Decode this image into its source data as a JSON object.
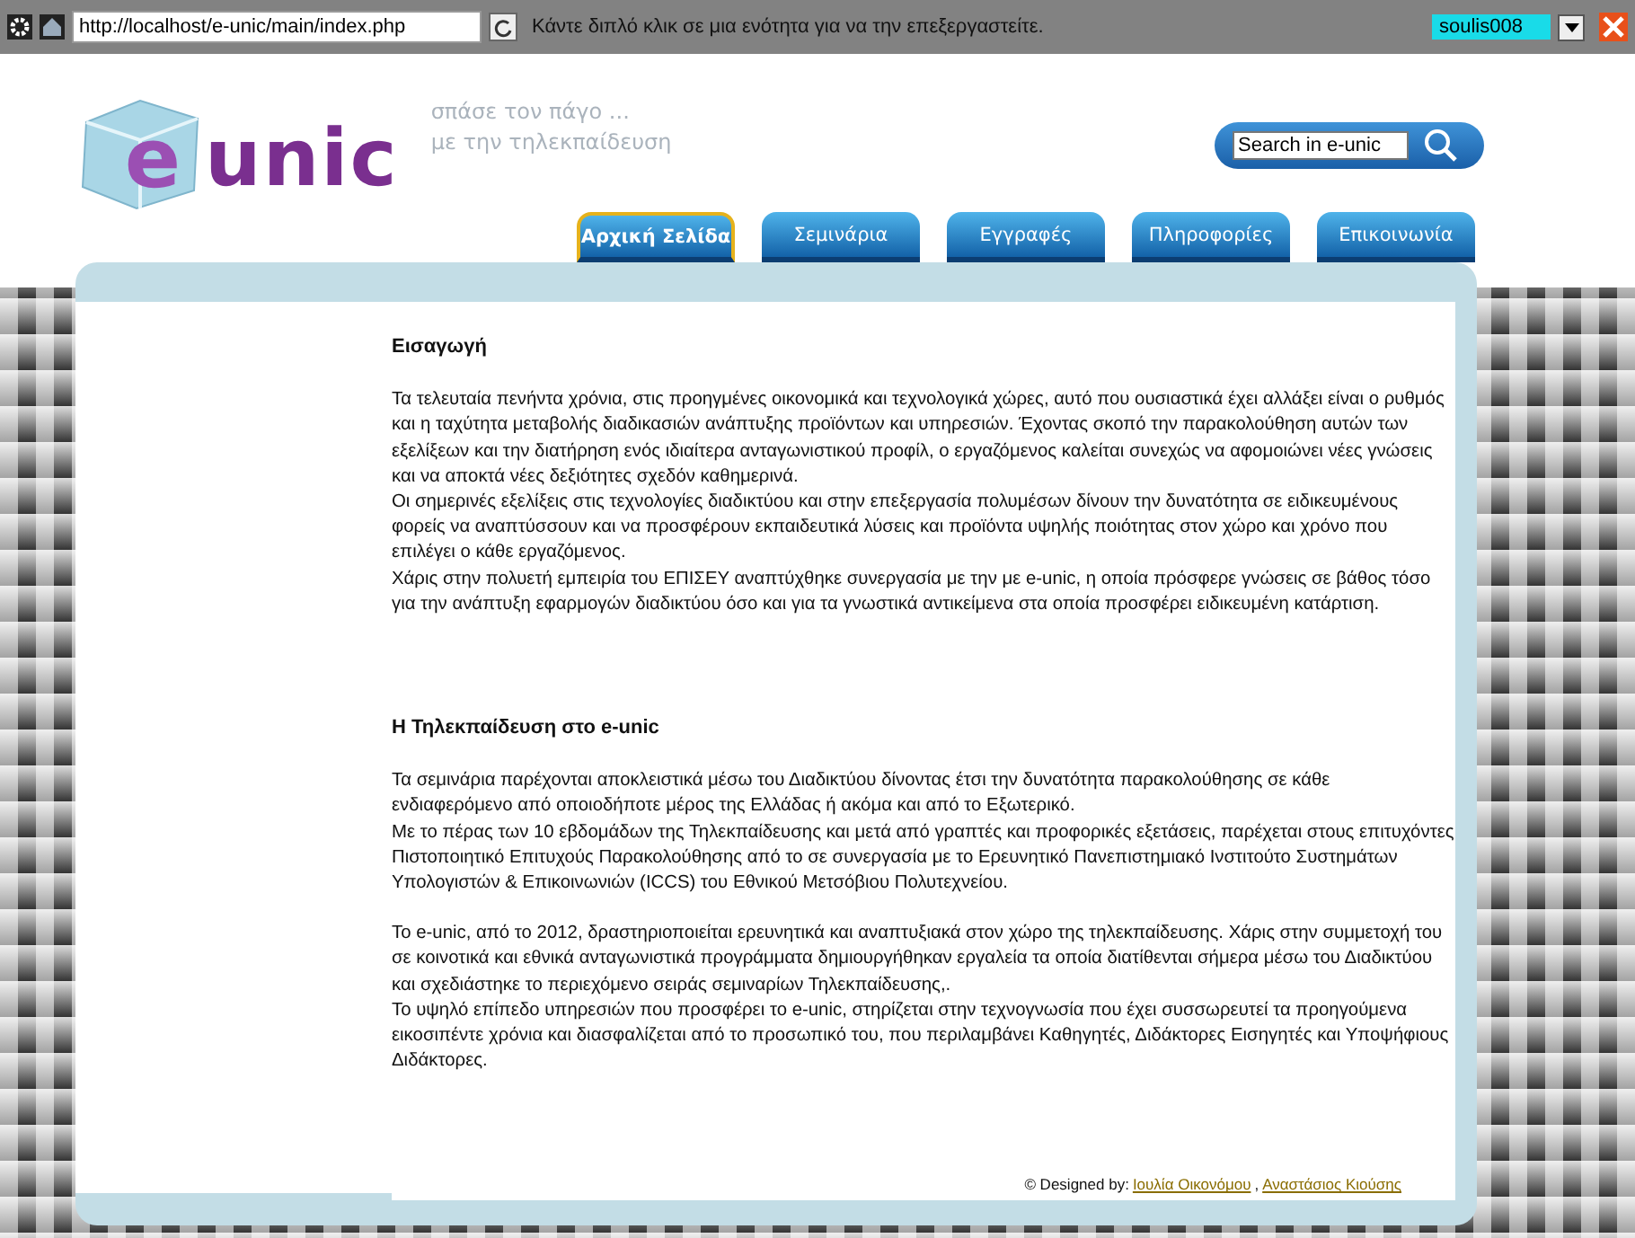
{
  "toolbar": {
    "address": "http://localhost/e-unic/main/index.php",
    "hint": "Κάντε διπλό κλικ σε μια ενότητα για να την επεξεργαστείτε.",
    "user": "soulis008"
  },
  "header": {
    "logo": {
      "letter": "e",
      "word": "unic"
    },
    "tagline": [
      "σπάσε τον πάγο ...",
      "με την τηλεκπαίδευση"
    ],
    "search": {
      "value": "Search in e-unic"
    }
  },
  "tabs": [
    {
      "label": "Αρχική Σελίδα",
      "selected": true
    },
    {
      "label": "Σεμινάρια",
      "selected": false
    },
    {
      "label": "Εγγραφές",
      "selected": false
    },
    {
      "label": "Πληροφορίες",
      "selected": false
    },
    {
      "label": "Επικοινωνία",
      "selected": false
    }
  ],
  "sections": [
    {
      "title": "Εισαγωγή",
      "paragraphs": [
        [
          "Τα τελευταία πενήντα χρόνια, στις προηγμένες οικονομικά και τεχνολογικά χώρες, αυτό που ουσιαστικά έχει αλλάξει είναι ο ρυθμός και η ταχύτητα μεταβολής διαδικασιών ανάπτυξης προϊόντων και υπηρεσιών. Έχοντας σκοπό την παρακολούθηση αυτών των εξελίξεων και την διατήρηση ενός ιδιαίτερα ανταγωνιστικού προφίλ, ο εργαζόμενος καλείται συνεχώς να αφομοιώνει νέες γνώσεις και να αποκτά νέες δεξιότητες σχεδόν καθημερινά.",
          "Οι σημερινές εξελίξεις στις τεχνολογίες διαδικτύου και στην επεξεργασία πολυμέσων δίνουν την δυνατότητα σε ειδικευμένους φορείς να αναπτύσσουν και να προσφέρουν εκπαιδευτικά λύσεις και προϊόντα υψηλής ποιότητας στον χώρο και χρόνο που επιλέγει ο κάθε εργαζόμενος.",
          "Χάρις στην πολυετή εμπειρία του ΕΠΙΣΕΥ αναπτύχθηκε συνεργασία με την με e-unic, η οποία πρόσφερε γνώσεις σε βάθος τόσο για την ανάπτυξη εφαρμογών διαδικτύου όσο και για τα γνωστικά αντικείμενα στα οποία προσφέρει ειδικευμένη κατάρτιση."
        ]
      ]
    },
    {
      "title": "Η Τηλεκπαίδευση στο e-unic",
      "paragraphs": [
        [
          "Τα σεμινάρια παρέχονται αποκλειστικά μέσω του Διαδικτύου δίνοντας έτσι την δυνατότητα παρακολούθησης σε κάθε ενδιαφερόμενο από οποιοδήποτε μέρος της Ελλάδας ή ακόμα και από το Εξωτερικό.",
          "Με το πέρας των 10 εβδομάδων της Τηλεκπαίδευσης και μετά από γραπτές και προφορικές εξετάσεις, παρέχεται στους επιτυχόντες Πιστοποιητικό Επιτυχούς Παρακολούθησης από το σε συνεργασία με το Ερευνητικό Πανεπιστημιακό Ινστιτούτο Συστημάτων Υπολογιστών & Επικοινωνιών (ICCS) του Εθνικού Μετσόβιου Πολυτεχνείου."
        ],
        [
          "Το e-unic, από το 2012, δραστηριοποιείται ερευνητικά και αναπτυξιακά στον χώρο της τηλεκπαίδευσης. Χάρις στην συμμετοχή του σε κοινοτικά και εθνικά ανταγωνιστικά προγράμματα δημιουργήθηκαν εργαλεία τα οποία διατίθενται σήμερα μέσω του Διαδικτύου και σχεδιάστηκε το περιεχόμενο σειράς σεμιναρίων Τηλεκπαίδευσης,.",
          "Το υψηλό επίπεδο υπηρεσιών που προσφέρει το e-unic, στηρίζεται στην τεχνογνωσία που έχει συσσωρευτεί τα προηγούμενα εικοσιπέντε χρόνια και διασφαλίζεται από το προσωπικό του, που περιλαμβάνει Καθηγητές, Διδάκτορες Εισηγητές και Υποψήφιους Διδάκτορες."
        ]
      ]
    }
  ],
  "footer": {
    "label": "© Designed by:",
    "authors": [
      "Ιουλία Οικονόμου",
      "Αναστάσιος Κιούσης"
    ],
    "separator": ","
  }
}
